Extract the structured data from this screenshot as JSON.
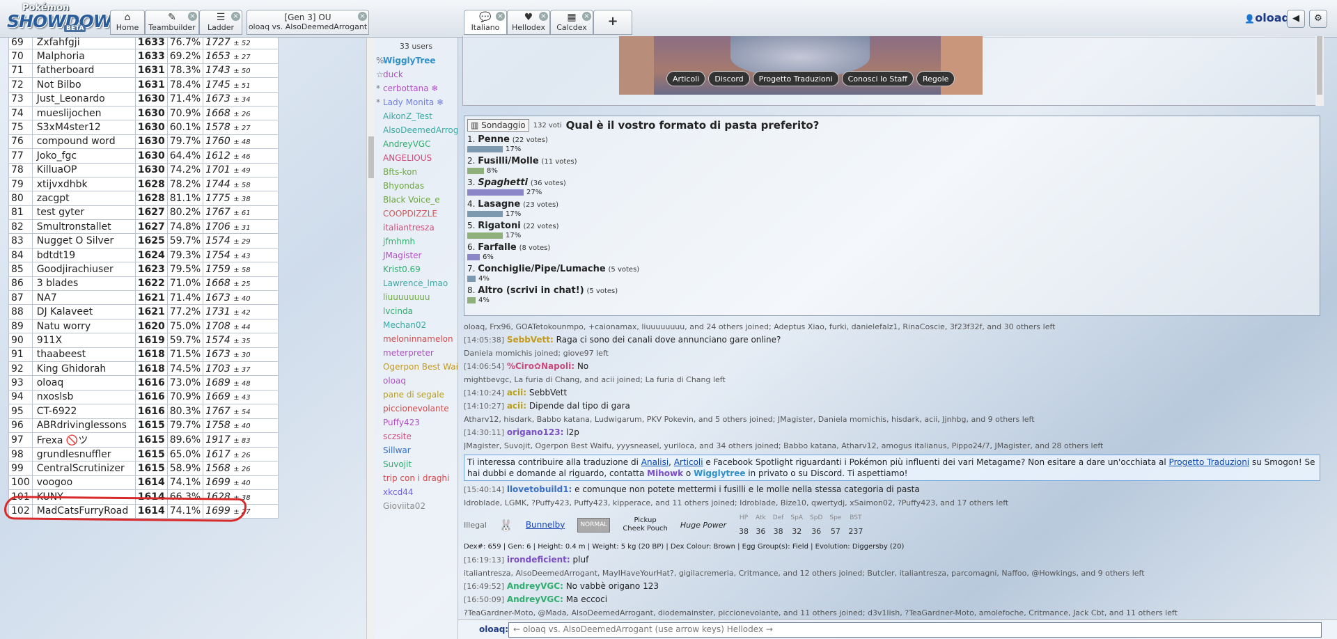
{
  "header": {
    "logo_top": "Pokémon",
    "logo_main": "SHOWDOWN",
    "logo_badge": "BETA",
    "tabs": [
      {
        "label": "Home",
        "icon": "home-icon"
      },
      {
        "label": "Teambuilder",
        "icon": "edit-icon"
      },
      {
        "label": "Ladder",
        "icon": "list-icon"
      }
    ],
    "battle_tab": {
      "line1": "[Gen 3] OU",
      "line2": "oloaq vs. AlsoDeemedArrogant"
    },
    "room_tabs": [
      {
        "label": "Italiano",
        "icon": "chat-icon"
      },
      {
        "label": "Hellodex",
        "icon": "heart-icon"
      },
      {
        "label": "Calcdex",
        "icon": "calculator-icon"
      }
    ],
    "add_tab": "+",
    "username": "oloaq",
    "sound_icon": "sound-icon",
    "settings_icon": "gear-icon"
  },
  "ladder": {
    "rows": [
      {
        "rank": "69",
        "name": "Zxfahfgji",
        "elo": "1633",
        "gxe": "76.7%",
        "glicko": "1727",
        "dev": "± 52"
      },
      {
        "rank": "70",
        "name": "Malphoria",
        "elo": "1633",
        "gxe": "69.2%",
        "glicko": "1653",
        "dev": "± 27"
      },
      {
        "rank": "71",
        "name": "fatherboard",
        "elo": "1631",
        "gxe": "78.3%",
        "glicko": "1743",
        "dev": "± 50"
      },
      {
        "rank": "72",
        "name": "Not Bilbo",
        "elo": "1631",
        "gxe": "78.4%",
        "glicko": "1745",
        "dev": "± 51"
      },
      {
        "rank": "73",
        "name": "Just_Leonardo",
        "elo": "1630",
        "gxe": "71.4%",
        "glicko": "1673",
        "dev": "± 34"
      },
      {
        "rank": "74",
        "name": "mueslijochen",
        "elo": "1630",
        "gxe": "70.9%",
        "glicko": "1668",
        "dev": "± 26"
      },
      {
        "rank": "75",
        "name": "S3xM4ster12",
        "elo": "1630",
        "gxe": "60.1%",
        "glicko": "1578",
        "dev": "± 27"
      },
      {
        "rank": "76",
        "name": "compound word",
        "elo": "1630",
        "gxe": "79.7%",
        "glicko": "1760",
        "dev": "± 48"
      },
      {
        "rank": "77",
        "name": "Joko_fgc",
        "elo": "1630",
        "gxe": "64.4%",
        "glicko": "1612",
        "dev": "± 46"
      },
      {
        "rank": "78",
        "name": "KilluaOP",
        "elo": "1630",
        "gxe": "74.2%",
        "glicko": "1701",
        "dev": "± 49"
      },
      {
        "rank": "79",
        "name": "xtijvxdhbk",
        "elo": "1628",
        "gxe": "78.2%",
        "glicko": "1744",
        "dev": "± 58"
      },
      {
        "rank": "80",
        "name": "zacgpt",
        "elo": "1628",
        "gxe": "81.1%",
        "glicko": "1775",
        "dev": "± 38"
      },
      {
        "rank": "81",
        "name": "test gyter",
        "elo": "1627",
        "gxe": "80.2%",
        "glicko": "1767",
        "dev": "± 61"
      },
      {
        "rank": "82",
        "name": "Smultronstallet",
        "elo": "1627",
        "gxe": "74.8%",
        "glicko": "1706",
        "dev": "± 31"
      },
      {
        "rank": "83",
        "name": "Nugget O Silver",
        "elo": "1625",
        "gxe": "59.7%",
        "glicko": "1574",
        "dev": "± 29"
      },
      {
        "rank": "84",
        "name": "bdtdt19",
        "elo": "1624",
        "gxe": "79.3%",
        "glicko": "1754",
        "dev": "± 43"
      },
      {
        "rank": "85",
        "name": "Goodjirachiuser",
        "elo": "1623",
        "gxe": "79.5%",
        "glicko": "1759",
        "dev": "± 58"
      },
      {
        "rank": "86",
        "name": "3 blades",
        "elo": "1622",
        "gxe": "71.0%",
        "glicko": "1668",
        "dev": "± 25"
      },
      {
        "rank": "87",
        "name": "NA7",
        "elo": "1621",
        "gxe": "71.4%",
        "glicko": "1673",
        "dev": "± 40"
      },
      {
        "rank": "88",
        "name": "DJ Kalaveet",
        "elo": "1621",
        "gxe": "77.2%",
        "glicko": "1731",
        "dev": "± 42"
      },
      {
        "rank": "89",
        "name": "Natu worry",
        "elo": "1620",
        "gxe": "75.0%",
        "glicko": "1708",
        "dev": "± 44"
      },
      {
        "rank": "90",
        "name": "911X",
        "elo": "1619",
        "gxe": "59.7%",
        "glicko": "1574",
        "dev": "± 35"
      },
      {
        "rank": "91",
        "name": "thaabeest",
        "elo": "1618",
        "gxe": "71.5%",
        "glicko": "1673",
        "dev": "± 30"
      },
      {
        "rank": "92",
        "name": "King Ghidorah",
        "elo": "1618",
        "gxe": "74.5%",
        "glicko": "1703",
        "dev": "± 37"
      },
      {
        "rank": "93",
        "name": "oloaq",
        "elo": "1616",
        "gxe": "73.0%",
        "glicko": "1689",
        "dev": "± 48"
      },
      {
        "rank": "94",
        "name": "nxoslsb",
        "elo": "1616",
        "gxe": "70.9%",
        "glicko": "1669",
        "dev": "± 43"
      },
      {
        "rank": "95",
        "name": "CT-6922",
        "elo": "1616",
        "gxe": "80.3%",
        "glicko": "1767",
        "dev": "± 54"
      },
      {
        "rank": "96",
        "name": "ABRdrivinglessons",
        "elo": "1615",
        "gxe": "79.7%",
        "glicko": "1758",
        "dev": "± 40"
      },
      {
        "rank": "97",
        "name": "Frexa 🚫ツ",
        "elo": "1615",
        "gxe": "89.6%",
        "glicko": "1917",
        "dev": "± 83"
      },
      {
        "rank": "98",
        "name": "grundlesnuffler",
        "elo": "1615",
        "gxe": "65.0%",
        "glicko": "1617",
        "dev": "± 26"
      },
      {
        "rank": "99",
        "name": "CentralScrutinizer",
        "elo": "1615",
        "gxe": "58.9%",
        "glicko": "1568",
        "dev": "± 26"
      },
      {
        "rank": "100",
        "name": "voogoo",
        "elo": "1614",
        "gxe": "74.1%",
        "glicko": "1699",
        "dev": "± 40"
      },
      {
        "rank": "101",
        "name": "KUNY",
        "elo": "1614",
        "gxe": "66.3%",
        "glicko": "1628",
        "dev": "± 38"
      },
      {
        "rank": "102",
        "name": "MadCatsFurryRoad",
        "elo": "1614",
        "gxe": "74.1%",
        "glicko": "1699",
        "dev": "± 27"
      }
    ]
  },
  "userlist": {
    "count": "33 users",
    "users": [
      {
        "g": "%",
        "n": "WigglyTree",
        "c": "#2f8fc9",
        "b": true
      },
      {
        "g": "☆",
        "n": "duck",
        "c": "#b04fc6"
      },
      {
        "g": "*",
        "n": "cerbottana ❄",
        "c": "#b04fc6"
      },
      {
        "g": "*",
        "n": "Lady Monita ❄",
        "c": "#6f7fe0"
      },
      {
        "g": "",
        "n": "AikonZ_Test",
        "c": "#3aa9a4"
      },
      {
        "g": "",
        "n": "AlsoDeemedArrogant",
        "c": "#3aa9a4"
      },
      {
        "g": "",
        "n": "AndreyVGC",
        "c": "#2fae6e"
      },
      {
        "g": "",
        "n": "ANGELIOUS",
        "c": "#d04a7a"
      },
      {
        "g": "",
        "n": "Bfts-kon",
        "c": "#6aa83a"
      },
      {
        "g": "",
        "n": "Bhyondas",
        "c": "#6aa83a"
      },
      {
        "g": "",
        "n": "Black Voice_e",
        "c": "#6aa83a"
      },
      {
        "g": "",
        "n": "COOPDIZZLE",
        "c": "#d05858"
      },
      {
        "g": "",
        "n": "italiantresza",
        "c": "#d04a7a"
      },
      {
        "g": "",
        "n": "jfmhmh",
        "c": "#2fae6e"
      },
      {
        "g": "",
        "n": "JMagister",
        "c": "#b04fc6"
      },
      {
        "g": "",
        "n": "Krist0.69",
        "c": "#2fae6e"
      },
      {
        "g": "",
        "n": "Lawrence_lmao",
        "c": "#3aa9a4"
      },
      {
        "g": "",
        "n": "liuuuuuuuu",
        "c": "#6aa83a"
      },
      {
        "g": "",
        "n": "lvcinda",
        "c": "#2fae6e"
      },
      {
        "g": "",
        "n": "Mechan02",
        "c": "#3aa9a4"
      },
      {
        "g": "",
        "n": "meloninnamelon",
        "c": "#d04a4a"
      },
      {
        "g": "",
        "n": "meterpreter",
        "c": "#b04fc6"
      },
      {
        "g": "",
        "n": "Ogerpon Best Waifu",
        "c": "#c49a1a"
      },
      {
        "g": "",
        "n": "oloaq",
        "c": "#b04fc6"
      },
      {
        "g": "",
        "n": "pane di segale",
        "c": "#b8a01a"
      },
      {
        "g": "",
        "n": "piccionevolante",
        "c": "#d04a4a"
      },
      {
        "g": "",
        "n": "Puffy423",
        "c": "#b04fc6"
      },
      {
        "g": "",
        "n": "sczsite",
        "c": "#d04a7a"
      },
      {
        "g": "",
        "n": "Sillwar",
        "c": "#2f6fc9"
      },
      {
        "g": "",
        "n": "Suvojit",
        "c": "#2fae6e"
      },
      {
        "g": "",
        "n": "trip con i draghi",
        "c": "#d04a4a"
      },
      {
        "g": "",
        "n": "xkcd44",
        "c": "#6f5fe0"
      },
      {
        "g": "",
        "n": "Gioviita02",
        "c": "#8a8a8a"
      }
    ]
  },
  "banner_links": [
    "Articoli",
    "Discord",
    "Progetto Traduzioni",
    "Conosci lo Staff",
    "Regole"
  ],
  "poll": {
    "badge": "Sondaggio",
    "votes": "132 voti",
    "question": "Qual è il vostro formato di pasta preferito?",
    "options": [
      {
        "num": "1.",
        "label": "Penne",
        "votes": "(22 votes)",
        "pct": "17%",
        "frac": 0.17,
        "color": "#7c99b0",
        "italic": false
      },
      {
        "num": "2.",
        "label": "Fusilli/Molle",
        "votes": "(11 votes)",
        "pct": "8%",
        "frac": 0.08,
        "color": "#8fb07a",
        "italic": false
      },
      {
        "num": "3.",
        "label": "Spaghetti",
        "votes": "(36 votes)",
        "pct": "27%",
        "frac": 0.27,
        "color": "#8a86c8",
        "italic": true
      },
      {
        "num": "4.",
        "label": "Lasagne",
        "votes": "(23 votes)",
        "pct": "17%",
        "frac": 0.17,
        "color": "#7c99b0",
        "italic": false
      },
      {
        "num": "5.",
        "label": "Rigatoni",
        "votes": "(22 votes)",
        "pct": "17%",
        "frac": 0.17,
        "color": "#8fb07a",
        "italic": false
      },
      {
        "num": "6.",
        "label": "Farfalle",
        "votes": "(8 votes)",
        "pct": "6%",
        "frac": 0.06,
        "color": "#8a86c8",
        "italic": false
      },
      {
        "num": "7.",
        "label": "Conchiglie/Pipe/Lumache",
        "votes": "(5 votes)",
        "pct": "4%",
        "frac": 0.04,
        "color": "#7c99b0",
        "italic": false
      },
      {
        "num": "8.",
        "label": "Altro (scrivi in chat!)",
        "votes": "(5 votes)",
        "pct": "4%",
        "frac": 0.04,
        "color": "#8fb07a",
        "italic": false
      }
    ]
  },
  "log": {
    "join1": "oloaq, Frx96, GOATetokounmpo, +caionamax, liuuuuuuuu, and 24 others joined; Adeptus Xiao, furki, danielefalz1, RinaCoscie, 3f23f32f, and 30 others left",
    "m1": {
      "ts": "[14:05:38]",
      "user": "SebbVett:",
      "color": "#c49a1a",
      "text": "Raga ci sono dei canali dove annunciano gare online?"
    },
    "join2": "Daniela momichis joined; giove97 left",
    "m2": {
      "ts": "[14:06:54]",
      "user": "%Ciro✿Napoli:",
      "color": "#c94a7a",
      "text": "No"
    },
    "join3": "mightbevgc, La furia di Chang, and acii joined; La furia di Chang left",
    "m3": {
      "ts": "[14:10:24]",
      "user": "acii:",
      "color": "#b8a01a",
      "text": "SebbVett"
    },
    "m4": {
      "ts": "[14:10:27]",
      "user": "acii:",
      "color": "#b8a01a",
      "text": "Dipende dal tipo di gara"
    },
    "join4": "Atharv12, hisdark, Babbo katana, Ludwigarum, PKV Pokevin, and 5 others joined; JMagister, Daniela momichis, hisdark, acii, Jjnhbg, and 9 others left",
    "m5": {
      "ts": "[14:30:11]",
      "user": "origano123:",
      "color": "#7a4fc6",
      "text": "l2p"
    },
    "join5": "JMagister, Suvojit, Ogerpon Best Waifu, yyysneasel, yuriloca, and 34 others joined; Babbo katana, Atharv12, amogus italianus, Pippo24/7, JMagister, and 28 others left",
    "ann": {
      "a": "Ti interessa contribuire alla traduzione di ",
      "l1": "Analisi",
      "b": ", ",
      "l2": "Articoli",
      "c": " e Facebook Spotlight riguardanti i Pokémon più influenti dei vari Metagame? Non esitare a dare un'occhiata al ",
      "l3": "Progetto Traduzioni",
      "d": " su Smogon! Se hai dubbi e domande al riguardo, contatta ",
      "u1": "Mihowk",
      "e": " o ",
      "u2": "Wigglytree",
      "f": " in privato o su Discord. Ti aspettiamo!"
    },
    "m6": {
      "ts": "[15:40:14]",
      "user": "llovetobuild1:",
      "color": "#3a6fc6",
      "text": "e comunque non potete mettermi i fusilli e le molle nella stessa categoria di pasta"
    },
    "join6": "Idroblade, LGMK, ?Puffy423, Puffy423, kipperace, and 11 others joined; Idroblade, Bize10, qwertydj, xSaimon02, ?Puffy423, and 17 others left",
    "dex": {
      "illegal": "Illegal",
      "mon": "Bunnelby",
      "type": "NORMAL",
      "ab1": "Pickup",
      "ab2": "Cheek Pouch",
      "hidden": "Huge Power",
      "stat_labels": [
        "HP",
        "Atk",
        "Def",
        "SpA",
        "SpD",
        "Spe",
        "BST"
      ],
      "stat_values": [
        "38",
        "36",
        "38",
        "32",
        "36",
        "57",
        "237"
      ],
      "info": "Dex#: 659 | Gen: 6 | Height: 0.4 m | Weight: 5 kg (20 BP) | Dex Colour: Brown | Egg Group(s): Field | Evolution: Diggersby (20)"
    },
    "m7": {
      "ts": "[16:19:13]",
      "user": "irondeficient:",
      "color": "#7a4fc6",
      "text": "pluf"
    },
    "join7": "italiantresza, AlsoDeemedArrogant, MayIHaveYourHat?, gigilacremeria, Critmance, and 12 others joined; Butcler, italiantresza, parcomagni, Naffoo, @Howkings, and 9 others left",
    "m8": {
      "ts": "[16:49:52]",
      "user": "AndreyVGC:",
      "color": "#2fae6e",
      "text": "No vabbè origano 123"
    },
    "m9": {
      "ts": "[16:50:09]",
      "user": "AndreyVGC:",
      "color": "#2fae6e",
      "text": "Ma eccoci"
    },
    "join8": "?TeaGardner-Moto, @Mada, AlsoDeemedArrogant, diodemainster, piccionevolante, and 11 others joined; d3v1lish, ?TeaGardner-Moto, amolefoche, Critmance, Jack Cbt, and 11 others left"
  },
  "input": {
    "label": "oloaq:",
    "placeholder": "← oloaq vs. AlsoDeemedArrogant (use arrow keys) Hellodex →"
  }
}
